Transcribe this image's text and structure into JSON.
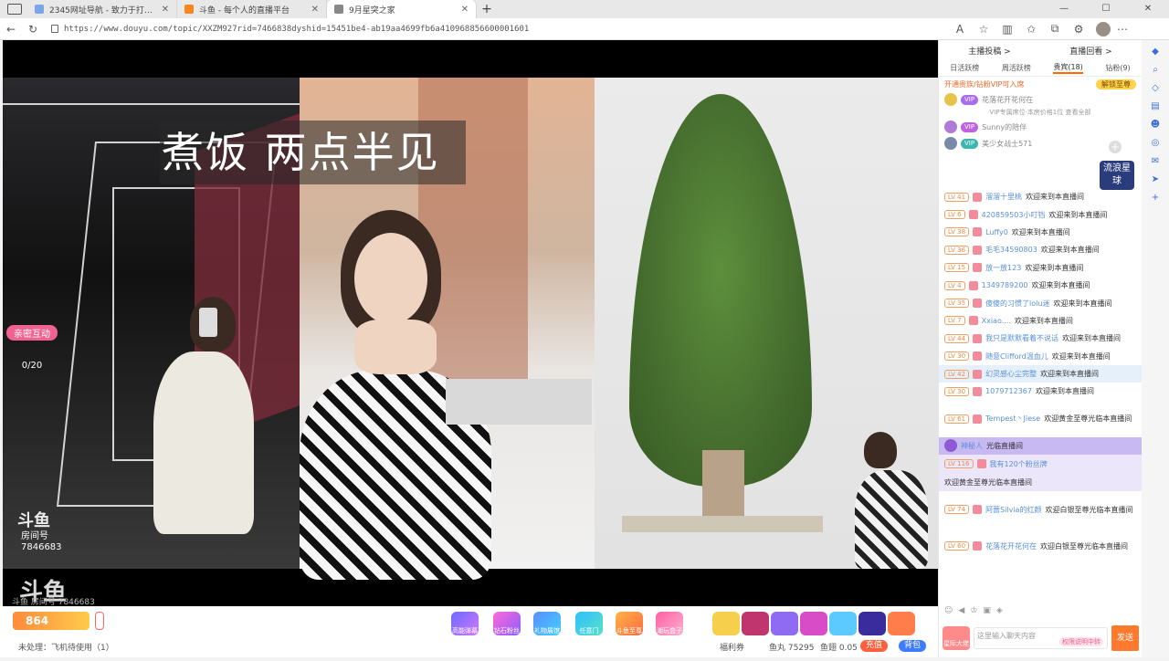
{
  "browser": {
    "tabs": [
      {
        "title": "2345网址导航 - 致力于打造百年"
      },
      {
        "title": "斗鱼 - 每个人的直播平台"
      },
      {
        "title": "9月星突之家",
        "active": true
      }
    ],
    "url": "https://www.douyu.com/topic/XXZM927rid=7466838dyshid=15451be4-ab19aa4699fb6a41096885660000160​1"
  },
  "player": {
    "caption": "煮饭 两点半见",
    "interact_label": "亲密互动",
    "interact_count": "0/20",
    "watermark_logo": "斗鱼",
    "room_label": "房间号",
    "room_number": "7846683",
    "watermark_room_line": "斗鱼 房间号 7846683"
  },
  "bottom": {
    "gift_labels": [
      "高能弹幕",
      "钻石粉丝",
      "礼物展馆",
      "任意门",
      "斗鱼至尊",
      "潮玩盒子"
    ],
    "left_count": "864",
    "pending_text": "未处理：飞机待使用（1）",
    "welfare": "福利券",
    "fish_balls": "鱼丸 75295",
    "fish_wings": "鱼翅 0.05",
    "recharge": "充值",
    "backpack": "背包"
  },
  "sidebar": {
    "top_links": [
      "主播投稿 >",
      "直播回看 >"
    ],
    "tabs": [
      "日活跃榜",
      "周活跃榜",
      "贵宾(18)",
      "钻粉(9)"
    ],
    "active_tab_index": 2,
    "notice": "开通贵族/钻粉VIP可入席",
    "unlock_button": "解锁至尊",
    "vip_rows": [
      {
        "name": "花落花开花何在"
      },
      {
        "name": "Sunny的陪伴"
      },
      {
        "name": "美少女战士571"
      }
    ],
    "vip_center": "VIP专属席位·本房价格1位 查看全部",
    "live_flag": "流浪星球",
    "messages": [
      {
        "lv": "LV 41",
        "user": "溜溜十里桃",
        "text": "欢迎来到本直播间"
      },
      {
        "lv": "LV 6",
        "user": "420859503小叮铛",
        "text": "欢迎来到本直播间"
      },
      {
        "lv": "LV 38",
        "user": "Luffy0",
        "text": "欢迎来到本直播间"
      },
      {
        "lv": "LV 36",
        "user": "毛毛34590803",
        "text": "欢迎来到本直播间"
      },
      {
        "lv": "LV 15",
        "user": "放一放123",
        "text": "欢迎来到本直播间"
      },
      {
        "lv": "LV 4",
        "user": "1349789200",
        "text": "欢迎来到本直播间"
      },
      {
        "lv": "LV 35",
        "user": "傻傻的习惯了lolu迷",
        "text": "欢迎来到本直播间"
      },
      {
        "lv": "LV 7",
        "user": "Xxiao....",
        "text": "欢迎来到本直播间"
      },
      {
        "lv": "LV 44",
        "user": "我只是默默看着不说话",
        "text": "欢迎来到本直播间"
      },
      {
        "lv": "LV 30",
        "user": "随意Clifford温血儿",
        "text": "欢迎来到本直播间"
      },
      {
        "lv": "LV 42",
        "user": "幻灵感心尘完整",
        "text": "欢迎来到本直播间",
        "style": "vip"
      },
      {
        "lv": "LV 30",
        "user": "1079712367",
        "text": "欢迎来到本直播间"
      },
      {
        "lv": "LV 61",
        "user": "Tempest丶Jiese",
        "text": "欢迎黄金至尊光临本直播间",
        "style": "wide"
      },
      {
        "lv": "",
        "user": "神秘人",
        "text": "光临直播间",
        "style": "purple"
      },
      {
        "lv": "LV 116",
        "user": "我有120个粉丝牌",
        "text": "欢迎黄金至尊光临本直播间",
        "style": "lilac wide"
      },
      {
        "lv": "LV 74",
        "user": "阿蔷Silvia的红颜",
        "text": "欢迎白银至尊光临本直播间",
        "style": "wide"
      },
      {
        "lv": "LV 60",
        "user": "花落花开花何在",
        "text": "欢迎白银至尊光临本直播间",
        "style": "wide"
      }
    ],
    "input_placeholder": "这里输入聊天内容",
    "input_hint": "权限说明中转",
    "send_label": "发送",
    "avatar_label": "星际大佬"
  }
}
